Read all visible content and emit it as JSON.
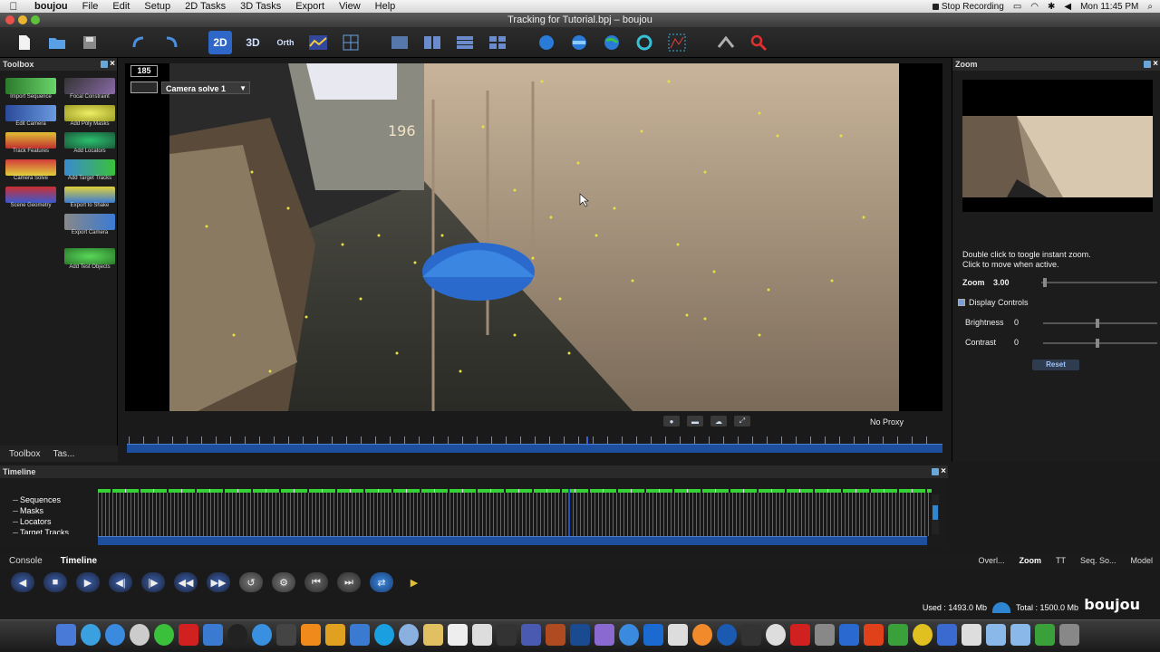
{
  "menubar": {
    "app": "boujou",
    "items": [
      "File",
      "Edit",
      "Setup",
      "2D Tasks",
      "3D Tasks",
      "Export",
      "View",
      "Help"
    ],
    "recording": "Stop Recording",
    "clock": "Mon 11:45 PM"
  },
  "window": {
    "title": "Tracking for Tutorial.bpj – boujou"
  },
  "toolbar": {
    "buttons": [
      "new-file",
      "open-file",
      "save",
      "undo",
      "redo",
      "2D",
      "3D",
      "Orth",
      "graph",
      "grid",
      "image",
      "split",
      "layers",
      "tracks",
      "solve",
      "camera",
      "globe",
      "orbit",
      "curve",
      "script",
      "search"
    ]
  },
  "toolbox": {
    "title": "Toolbox",
    "tools": [
      {
        "label": "Import Sequence",
        "color": "#3aa13a"
      },
      {
        "label": "Focal Constraint",
        "color": "#8a6aa8"
      },
      {
        "label": "Edit Camera",
        "color": "#3c7bd4"
      },
      {
        "label": "Add Poly Masks",
        "color": "#e0e03a"
      },
      {
        "label": "Track Features",
        "color": "#e0c034"
      },
      {
        "label": "Add Locators",
        "color": "#2cc06e"
      },
      {
        "label": "Camera Solve",
        "color": "#d33a3a"
      },
      {
        "label": "Add Target Tracks",
        "color": "#3a8ad0"
      },
      {
        "label": "Scene Geometry",
        "color": "#cc2e2e"
      },
      {
        "label": "Export to Shake",
        "color": "#3a7bd4"
      },
      {
        "label": "",
        "color": ""
      },
      {
        "label": "Export Camera",
        "color": "#3a7bd4"
      },
      {
        "label": "",
        "color": ""
      },
      {
        "label": "Add Test Objects",
        "color": "#3ab63a"
      }
    ],
    "tabs": [
      "Toolbox",
      "Tas..."
    ]
  },
  "viewer": {
    "frame": "185",
    "solve_select": "Camera solve 1",
    "proxy": "No Proxy",
    "overlay_number": "196"
  },
  "zoom_panel": {
    "title": "Zoom",
    "hint_line1": "Double click to toogle instant zoom.",
    "hint_line2": "Click to move when active.",
    "zoom_label": "Zoom",
    "zoom_value": "3.00",
    "display_controls": "Display Controls",
    "brightness_label": "Brightness",
    "brightness_value": "0",
    "contrast_label": "Contrast",
    "contrast_value": "0",
    "reset_label": "Reset"
  },
  "timeline": {
    "title": "Timeline",
    "tree": [
      "Sequences",
      "Masks",
      "Locators",
      "Target Tracks"
    ]
  },
  "bottom_tabs": [
    "Console",
    "Timeline"
  ],
  "right_tabs": [
    "Overl...",
    "Zoom",
    "TT",
    "Seq. So...",
    "Model"
  ],
  "status": {
    "used": "Used : 1493.0 Mb",
    "total": "Total : 1500.0 Mb",
    "brand": "boujou"
  },
  "colors": {
    "accent": "#1d4f9e",
    "track_green": "#36d136",
    "track_yellow": "#f0e040"
  }
}
